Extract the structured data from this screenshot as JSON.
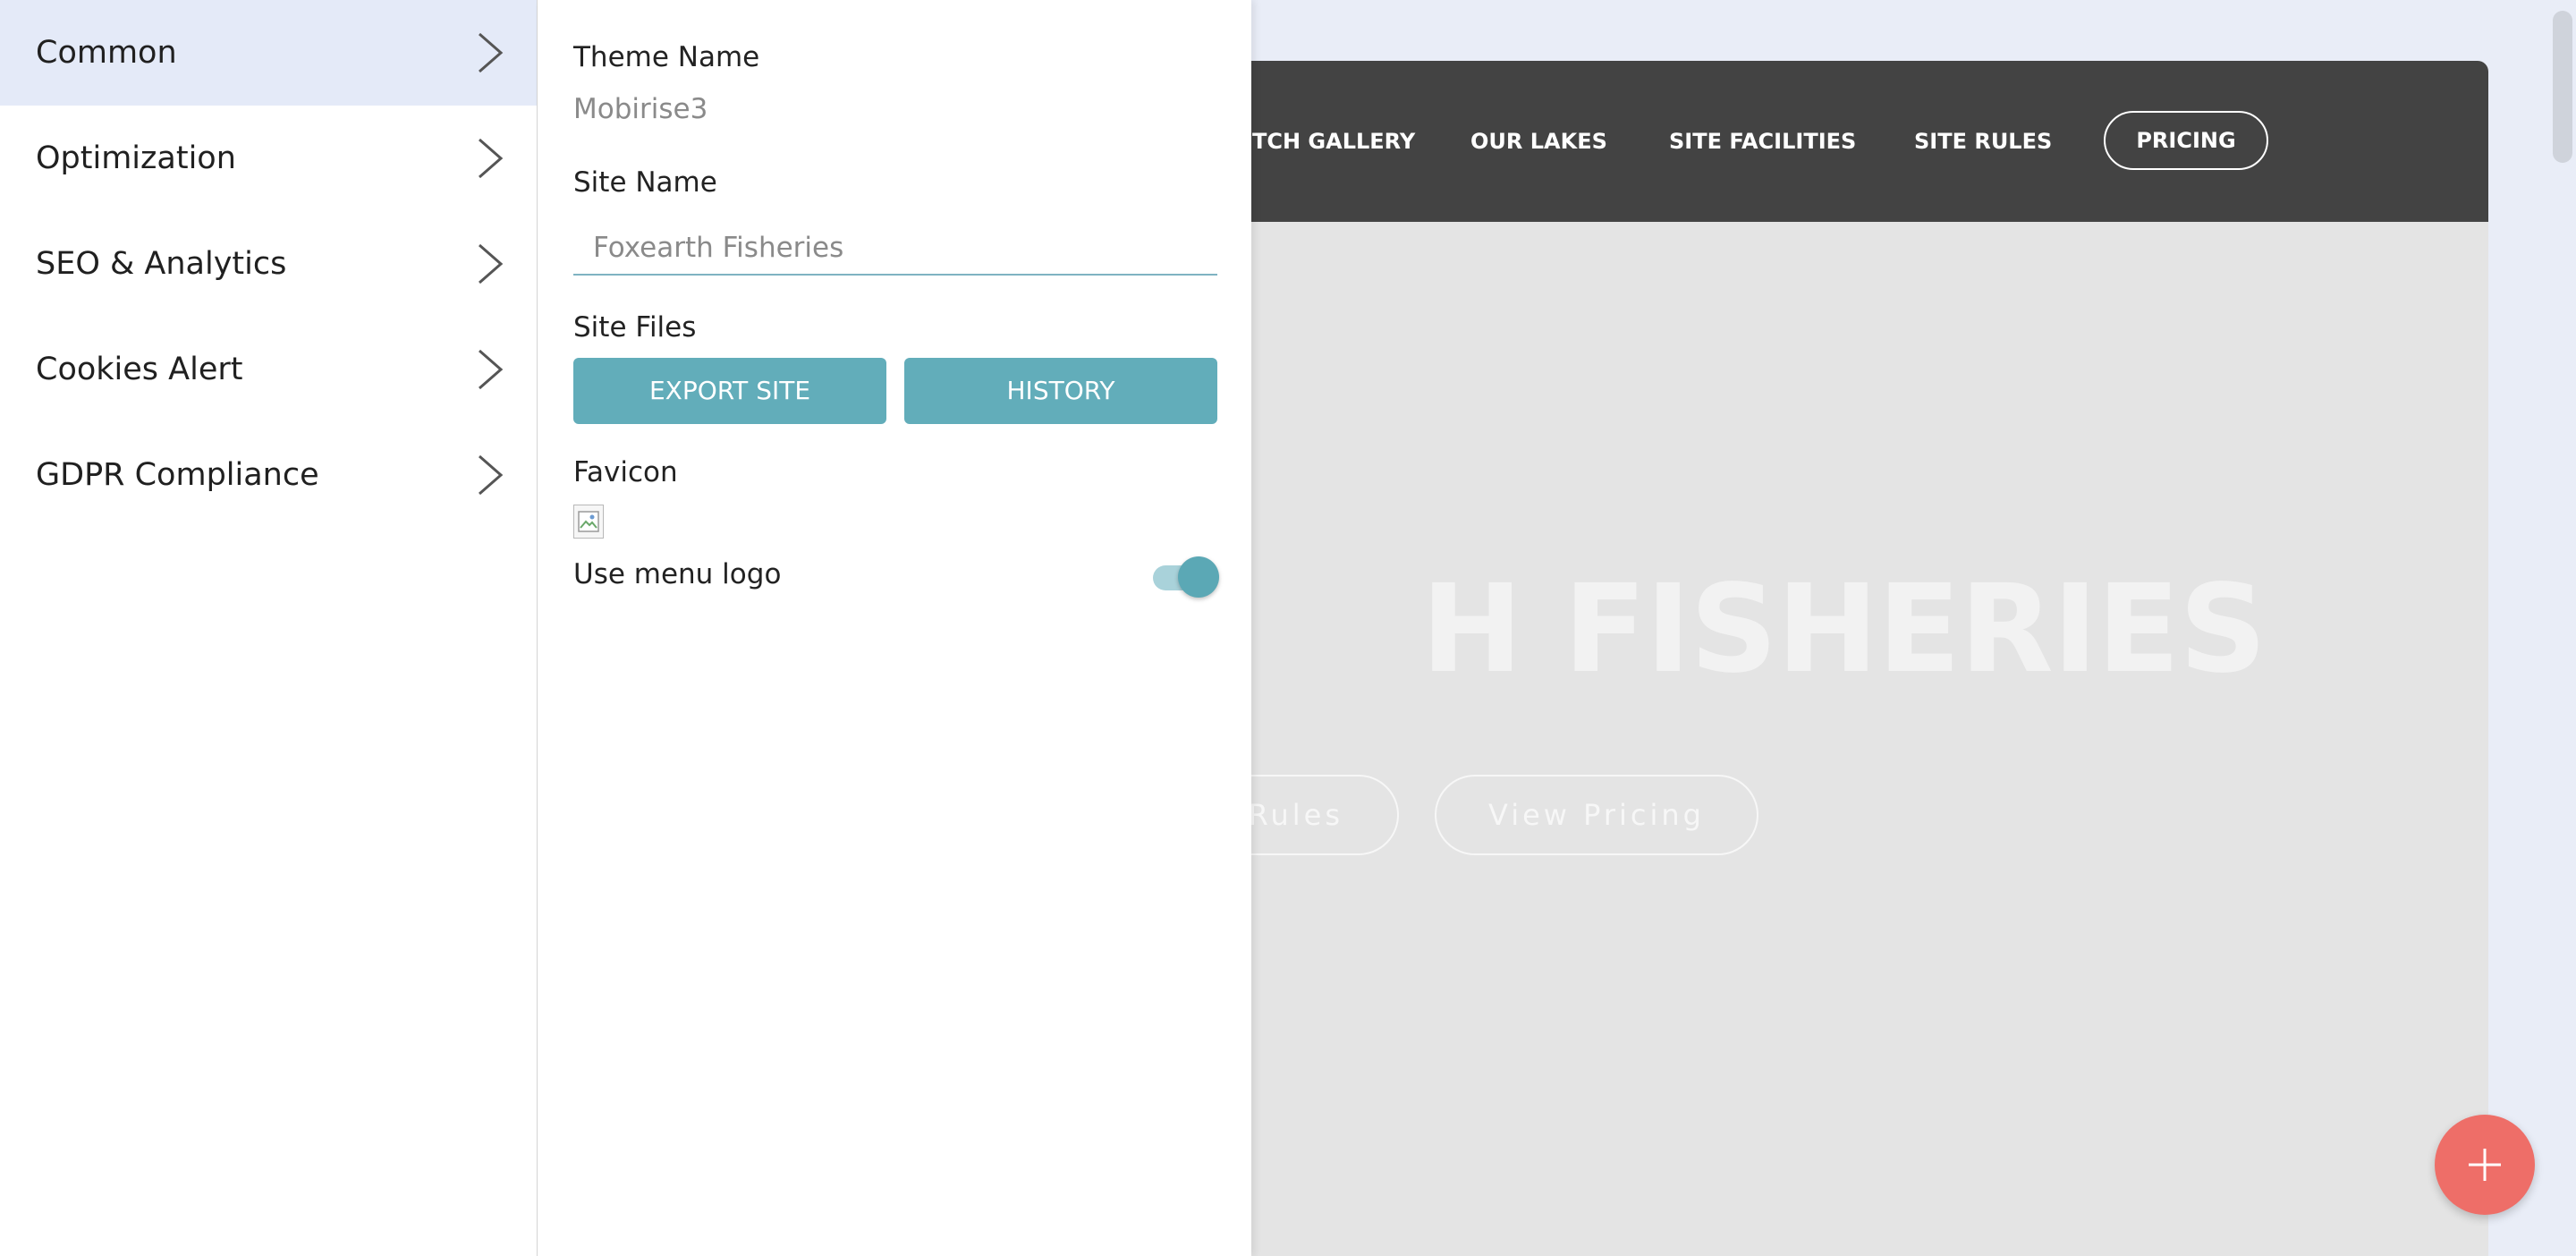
{
  "menu": {
    "items": [
      {
        "label": "Common",
        "active": true
      },
      {
        "label": "Optimization"
      },
      {
        "label": "SEO & Analytics"
      },
      {
        "label": "Cookies Alert"
      },
      {
        "label": "GDPR Compliance"
      }
    ]
  },
  "settings": {
    "theme_name_label": "Theme Name",
    "theme_name_value": "Mobirise3",
    "site_name_label": "Site Name",
    "site_name_placeholder": "Foxearth Fisheries",
    "site_files_label": "Site Files",
    "export_label": "EXPORT SITE",
    "history_label": "HISTORY",
    "favicon_label": "Favicon",
    "use_menu_logo_label": "Use menu logo",
    "use_menu_logo_on": true
  },
  "preview": {
    "nav": {
      "links": [
        "TCH GALLERY",
        "OUR LAKES",
        "SITE FACILITIES",
        "SITE RULES"
      ],
      "pricing_label": "PRICING"
    },
    "hero_title": "H FISHERIES",
    "hero_buttons": [
      "Rules",
      "View Pricing"
    ]
  },
  "colors": {
    "accent": "#62adba",
    "nav_bg": "#434343",
    "fab": "#ee6e68"
  },
  "icons": {
    "menu_chevron": "chevron-right-icon",
    "fab": "plus-icon",
    "scroll": "chevron-down-icon"
  }
}
